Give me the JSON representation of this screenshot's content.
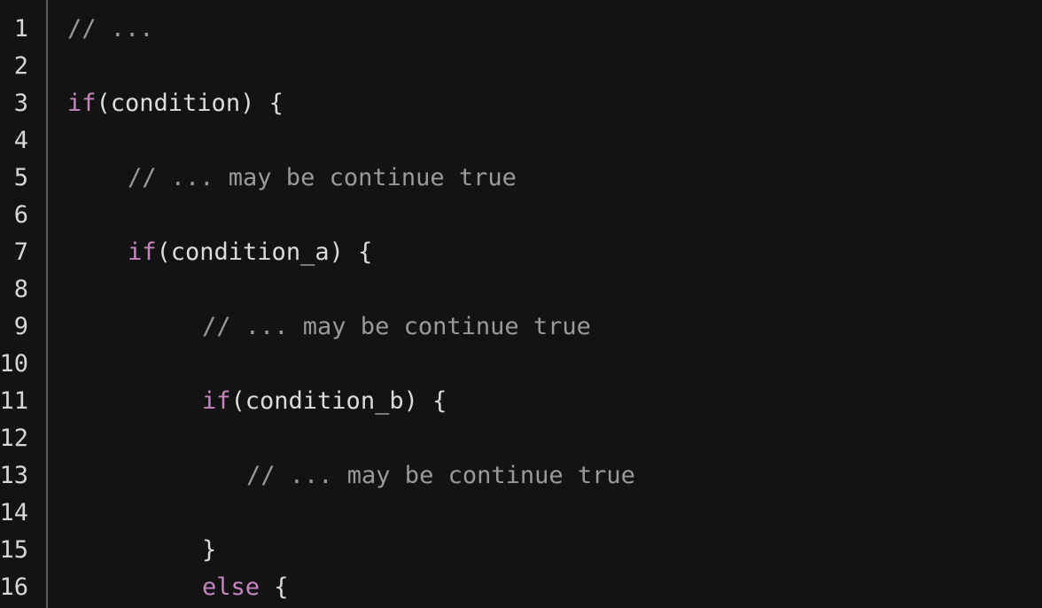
{
  "editor": {
    "lines": [
      {
        "number": "1",
        "indent": 0,
        "tokens": [
          {
            "type": "comment",
            "text": "// ..."
          }
        ]
      },
      {
        "number": "2",
        "indent": 0,
        "tokens": []
      },
      {
        "number": "3",
        "indent": 0,
        "tokens": [
          {
            "type": "keyword",
            "text": "if"
          },
          {
            "type": "text",
            "text": "(condition) {"
          }
        ]
      },
      {
        "number": "4",
        "indent": 0,
        "tokens": []
      },
      {
        "number": "5",
        "indent": 1,
        "tokens": [
          {
            "type": "comment",
            "text": "// ... may be continue true"
          }
        ]
      },
      {
        "number": "6",
        "indent": 0,
        "tokens": []
      },
      {
        "number": "7",
        "indent": 1,
        "tokens": [
          {
            "type": "keyword",
            "text": "if"
          },
          {
            "type": "text",
            "text": "(condition_a) {"
          }
        ]
      },
      {
        "number": "8",
        "indent": 0,
        "tokens": []
      },
      {
        "number": "9",
        "indent": 2,
        "tokens": [
          {
            "type": "comment",
            "text": "// ... may be continue true"
          }
        ]
      },
      {
        "number": "10",
        "indent": 0,
        "tokens": []
      },
      {
        "number": "11",
        "indent": 2,
        "tokens": [
          {
            "type": "keyword",
            "text": "if"
          },
          {
            "type": "text",
            "text": "(condition_b) {"
          }
        ]
      },
      {
        "number": "12",
        "indent": 0,
        "tokens": []
      },
      {
        "number": "13",
        "indent": 3,
        "tokens": [
          {
            "type": "comment",
            "text": "// ... may be continue true"
          }
        ]
      },
      {
        "number": "14",
        "indent": 0,
        "tokens": []
      },
      {
        "number": "15",
        "indent": 2,
        "tokens": [
          {
            "type": "text",
            "text": "}"
          }
        ]
      },
      {
        "number": "16",
        "indent": 2,
        "tokens": [
          {
            "type": "keyword",
            "text": "else"
          },
          {
            "type": "text",
            "text": " {"
          }
        ]
      }
    ]
  },
  "colors": {
    "background": "#131313",
    "keyword": "#c586c0",
    "comment": "#9a9a9a",
    "text": "#dcdcdc",
    "line_number": "#d6d6d6",
    "gutter_border": "#5a5a5a"
  }
}
